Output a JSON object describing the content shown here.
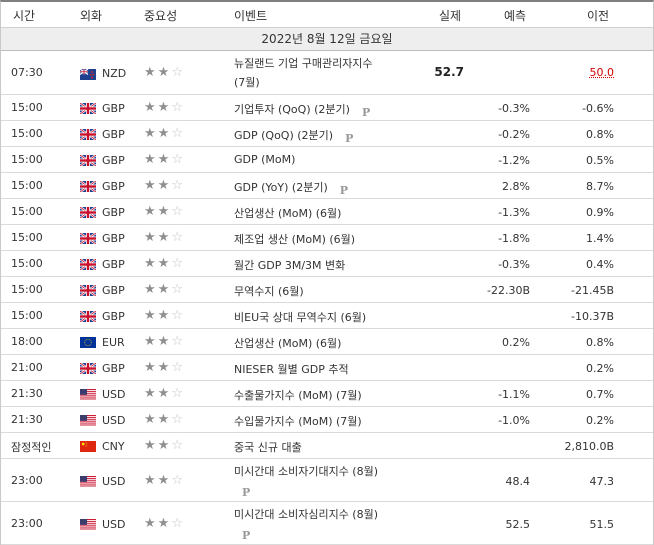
{
  "header": {
    "time": "시간",
    "currency": "외화",
    "importance": "중요성",
    "event": "이벤트",
    "actual": "실제",
    "forecast": "예측",
    "previous": "이전"
  },
  "date_label": "2022년 8월 12일 금요일",
  "premium_marker": "P",
  "colors": {
    "previous_revised": "#d40000",
    "date_band": "#eeeeee",
    "stars_filled": "#8f8f8f",
    "stars_empty": "#c4c4c4"
  },
  "rows": [
    {
      "time": "07:30",
      "flag": "nz-flag",
      "currency": "NZD",
      "importance": 2,
      "event_line1": "뉴질랜드 기업 구매관리자지수",
      "event_line2": "(7월)",
      "actual": "52.7",
      "forecast": "",
      "previous": "50.0",
      "previous_revised": true,
      "premium": false
    },
    {
      "time": "15:00",
      "flag": "uk-flag",
      "currency": "GBP",
      "importance": 2,
      "event": "기업투자 (QoQ) (2분기)",
      "actual": "",
      "forecast": "-0.3%",
      "previous": "-0.6%",
      "premium": true
    },
    {
      "time": "15:00",
      "flag": "uk-flag",
      "currency": "GBP",
      "importance": 2,
      "event": "GDP (QoQ) (2분기)",
      "actual": "",
      "forecast": "-0.2%",
      "previous": "0.8%",
      "premium": true
    },
    {
      "time": "15:00",
      "flag": "uk-flag",
      "currency": "GBP",
      "importance": 2,
      "event": "GDP (MoM)",
      "actual": "",
      "forecast": "-1.2%",
      "previous": "0.5%",
      "premium": false
    },
    {
      "time": "15:00",
      "flag": "uk-flag",
      "currency": "GBP",
      "importance": 2,
      "event": "GDP (YoY) (2분기)",
      "actual": "",
      "forecast": "2.8%",
      "previous": "8.7%",
      "premium": true
    },
    {
      "time": "15:00",
      "flag": "uk-flag",
      "currency": "GBP",
      "importance": 2,
      "event": "산업생산 (MoM) (6월)",
      "actual": "",
      "forecast": "-1.3%",
      "previous": "0.9%",
      "premium": false
    },
    {
      "time": "15:00",
      "flag": "uk-flag",
      "currency": "GBP",
      "importance": 2,
      "event": "제조업 생산 (MoM) (6월)",
      "actual": "",
      "forecast": "-1.8%",
      "previous": "1.4%",
      "premium": false
    },
    {
      "time": "15:00",
      "flag": "uk-flag",
      "currency": "GBP",
      "importance": 2,
      "event": "월간 GDP 3M/3M 변화",
      "actual": "",
      "forecast": "-0.3%",
      "previous": "0.4%",
      "premium": false
    },
    {
      "time": "15:00",
      "flag": "uk-flag",
      "currency": "GBP",
      "importance": 2,
      "event": "무역수지 (6월)",
      "actual": "",
      "forecast": "-22.30B",
      "previous": "-21.45B",
      "premium": false
    },
    {
      "time": "15:00",
      "flag": "uk-flag",
      "currency": "GBP",
      "importance": 2,
      "event": "비EU국 상대 무역수지 (6월)",
      "actual": "",
      "forecast": "",
      "previous": "-10.37B",
      "premium": false
    },
    {
      "time": "18:00",
      "flag": "eu-flag",
      "currency": "EUR",
      "importance": 2,
      "event": "산업생산 (MoM) (6월)",
      "actual": "",
      "forecast": "0.2%",
      "previous": "0.8%",
      "premium": false
    },
    {
      "time": "21:00",
      "flag": "uk-flag",
      "currency": "GBP",
      "importance": 2,
      "event": "NIESER 월별 GDP 추적",
      "actual": "",
      "forecast": "",
      "previous": "0.2%",
      "premium": false
    },
    {
      "time": "21:30",
      "flag": "us-flag",
      "currency": "USD",
      "importance": 2,
      "event": "수출물가지수 (MoM) (7월)",
      "actual": "",
      "forecast": "-1.1%",
      "previous": "0.7%",
      "premium": false
    },
    {
      "time": "21:30",
      "flag": "us-flag",
      "currency": "USD",
      "importance": 2,
      "event": "수입물가지수 (MoM) (7월)",
      "actual": "",
      "forecast": "-1.0%",
      "previous": "0.2%",
      "premium": false
    },
    {
      "time": "잠정적인",
      "flag": "cn-flag",
      "currency": "CNY",
      "importance": 2,
      "event": "중국 신규 대출",
      "actual": "",
      "forecast": "",
      "previous": "2,810.0B",
      "premium": false
    },
    {
      "time": "23:00",
      "flag": "us-flag",
      "currency": "USD",
      "importance": 2,
      "event": "미시간대 소비자기대지수 (8월)",
      "actual": "",
      "forecast": "48.4",
      "previous": "47.3",
      "premium": true,
      "premium_below": true
    },
    {
      "time": "23:00",
      "flag": "us-flag",
      "currency": "USD",
      "importance": 2,
      "event": "미시간대 소비자심리지수 (8월)",
      "actual": "",
      "forecast": "52.5",
      "previous": "51.5",
      "premium": true,
      "premium_below": true
    }
  ]
}
